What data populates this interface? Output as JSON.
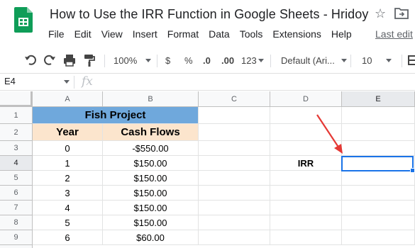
{
  "doc": {
    "title": "How to Use the IRR Function in Google Sheets - Hridoy",
    "last_edit": "Last edit"
  },
  "menu": [
    "File",
    "Edit",
    "View",
    "Insert",
    "Format",
    "Data",
    "Tools",
    "Extensions",
    "Help"
  ],
  "toolbar": {
    "zoom": "100%",
    "currency": "$",
    "percent": "%",
    "decrease_decimal": ".0",
    "increase_decimal": ".00",
    "more_formats": "123",
    "font": "Default (Ari...",
    "font_size": "10"
  },
  "formula_bar": {
    "cell_ref": "E4",
    "fx": "fx"
  },
  "columns": [
    "A",
    "B",
    "C",
    "D",
    "E"
  ],
  "rows": [
    "1",
    "2",
    "3",
    "4",
    "5",
    "6",
    "7",
    "8",
    "9"
  ],
  "sheet": {
    "project_title": "Fish Project",
    "year_header": "Year",
    "cash_header": "Cash Flows",
    "years": [
      "0",
      "1",
      "2",
      "3",
      "4",
      "5",
      "6"
    ],
    "cash_flows": [
      "-$550.00",
      "$150.00",
      "$150.00",
      "$150.00",
      "$150.00",
      "$150.00",
      "$60.00"
    ],
    "irr_label": "IRR"
  },
  "colors": {
    "title_fill": "#6fa8dc",
    "header_fill": "#fce5cd",
    "selection": "#1a73e8",
    "arrow": "#e53935"
  }
}
